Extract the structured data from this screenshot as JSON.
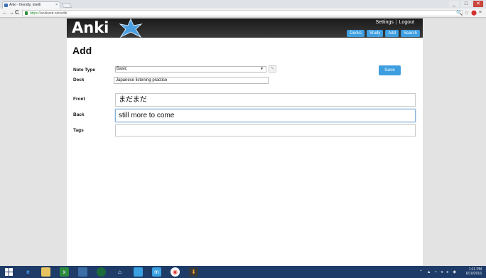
{
  "browser": {
    "tab_title": "Anki - friendly, intelli",
    "tab_close": "×",
    "url_scheme": "https://",
    "url_rest": "ankiweb.net/edit/",
    "back": "←",
    "forward": "→",
    "reload": "C",
    "window_minimize": "_",
    "window_maximize": "□",
    "window_close": "✕",
    "addr_icons": [
      "🔍",
      "☆",
      "⬤",
      "≡"
    ]
  },
  "header": {
    "logo_text": "Anki",
    "links": {
      "settings": "Settings",
      "separator": "|",
      "logout": "Logout"
    },
    "nav": [
      "Decks",
      "Study",
      "Add",
      "Search"
    ]
  },
  "form": {
    "title": "Add",
    "note_type_label": "Note Type",
    "note_type_value": "Basic",
    "deck_label": "Deck",
    "deck_value": "Japanese listening practice",
    "save_label": "Save",
    "fields": [
      {
        "label": "Front",
        "value": "まだまだ"
      },
      {
        "label": "Back",
        "value": "still more to come"
      },
      {
        "label": "Tags",
        "value": ""
      }
    ]
  },
  "taskbar": {
    "clock_time": "1:11 PM",
    "clock_date": "6/10/2016"
  },
  "colors": {
    "accent": "#3e9ee0",
    "header_bg": "#2a2a2a",
    "taskbar_bg": "#1f3c68"
  }
}
